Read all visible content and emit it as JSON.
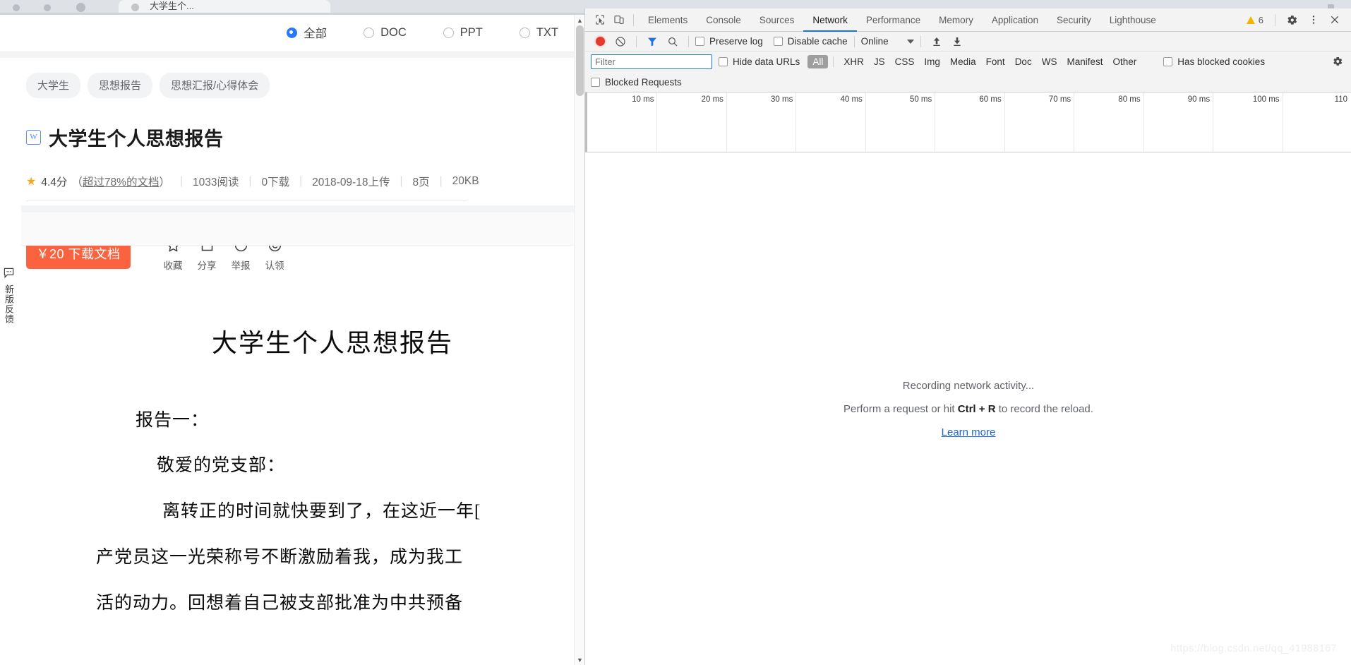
{
  "browser": {
    "tab_title": "大学生个..."
  },
  "page": {
    "filter": {
      "options": [
        {
          "label": "全部",
          "checked": true
        },
        {
          "label": "DOC",
          "checked": false
        },
        {
          "label": "PPT",
          "checked": false
        },
        {
          "label": "TXT",
          "checked": false
        }
      ]
    },
    "tags": [
      "大学生",
      "思想报告",
      "思想汇报/心得体会"
    ],
    "doc": {
      "type_badge": "W",
      "title": "大学生个人思想报告",
      "rating_icon": "star-icon",
      "rating": "4.4分",
      "rating_note": "（超过78%的文档）",
      "rating_note_underline": "超过78%的文档",
      "reads": "1033阅读",
      "downloads": "0下载",
      "upload_date": "2018-09-18上传",
      "pages": "8页",
      "size": "20KB",
      "description": "大学生个人思想报告"
    },
    "actions": {
      "download_label": "￥20 下载文档",
      "icons": [
        {
          "name": "star-outline-icon",
          "label": "收藏"
        },
        {
          "name": "share-icon",
          "label": "分享"
        },
        {
          "name": "report-icon",
          "label": "举报"
        },
        {
          "name": "copyright-claim-icon",
          "label": "认领"
        }
      ]
    },
    "feedback_tab": {
      "icon": "speech-bubble-icon",
      "label": "新版反馈"
    },
    "viewer": {
      "heading": "大学生个人思想报告",
      "paragraphs": [
        "报告一：",
        "敬爱的党支部：",
        "离转正的时间就快要到了，在这近一年[",
        "产党员这一光荣称号不断激励着我，成为我工",
        "活的动力。回想着自己被支部批准为中共预备"
      ]
    }
  },
  "devtools": {
    "left_buttons": [
      {
        "name": "inspect-element-icon"
      },
      {
        "name": "device-toolbar-icon"
      }
    ],
    "tabs": [
      {
        "label": "Elements",
        "active": false
      },
      {
        "label": "Console",
        "active": false
      },
      {
        "label": "Sources",
        "active": false
      },
      {
        "label": "Network",
        "active": true
      },
      {
        "label": "Performance",
        "active": false
      },
      {
        "label": "Memory",
        "active": false
      },
      {
        "label": "Application",
        "active": false
      },
      {
        "label": "Security",
        "active": false
      },
      {
        "label": "Lighthouse",
        "active": false
      }
    ],
    "warning_count": "6",
    "toolbar": {
      "record_label": "record-button",
      "clear_label": "clear-button",
      "filter_toggle_label": "filter-toggle",
      "search_label": "search-button",
      "preserve_log": "Preserve log",
      "disable_cache": "Disable cache",
      "throttle_value": "Online",
      "import_label": "import-har",
      "export_label": "export-har"
    },
    "filter_bar": {
      "filter_placeholder": "Filter",
      "filter_value": "",
      "hide_data_urls": "Hide data URLs",
      "types": [
        {
          "label": "All",
          "active": true
        },
        {
          "label": "XHR",
          "active": false
        },
        {
          "label": "JS",
          "active": false
        },
        {
          "label": "CSS",
          "active": false
        },
        {
          "label": "Img",
          "active": false
        },
        {
          "label": "Media",
          "active": false
        },
        {
          "label": "Font",
          "active": false
        },
        {
          "label": "Doc",
          "active": false
        },
        {
          "label": "WS",
          "active": false
        },
        {
          "label": "Manifest",
          "active": false
        },
        {
          "label": "Other",
          "active": false
        }
      ],
      "has_blocked_cookies": "Has blocked cookies",
      "blocked_requests": "Blocked Requests"
    },
    "overview": {
      "ticks": [
        "10 ms",
        "20 ms",
        "30 ms",
        "40 ms",
        "50 ms",
        "60 ms",
        "70 ms",
        "80 ms",
        "90 ms",
        "100 ms",
        "110"
      ]
    },
    "empty_state": {
      "line1": "Recording network activity...",
      "line2_pre": "Perform a request or hit ",
      "line2_key": "Ctrl + R",
      "line2_post": " to record the reload.",
      "link": "Learn more"
    }
  },
  "watermark": "https://blog.csdn.net/qq_41988167"
}
